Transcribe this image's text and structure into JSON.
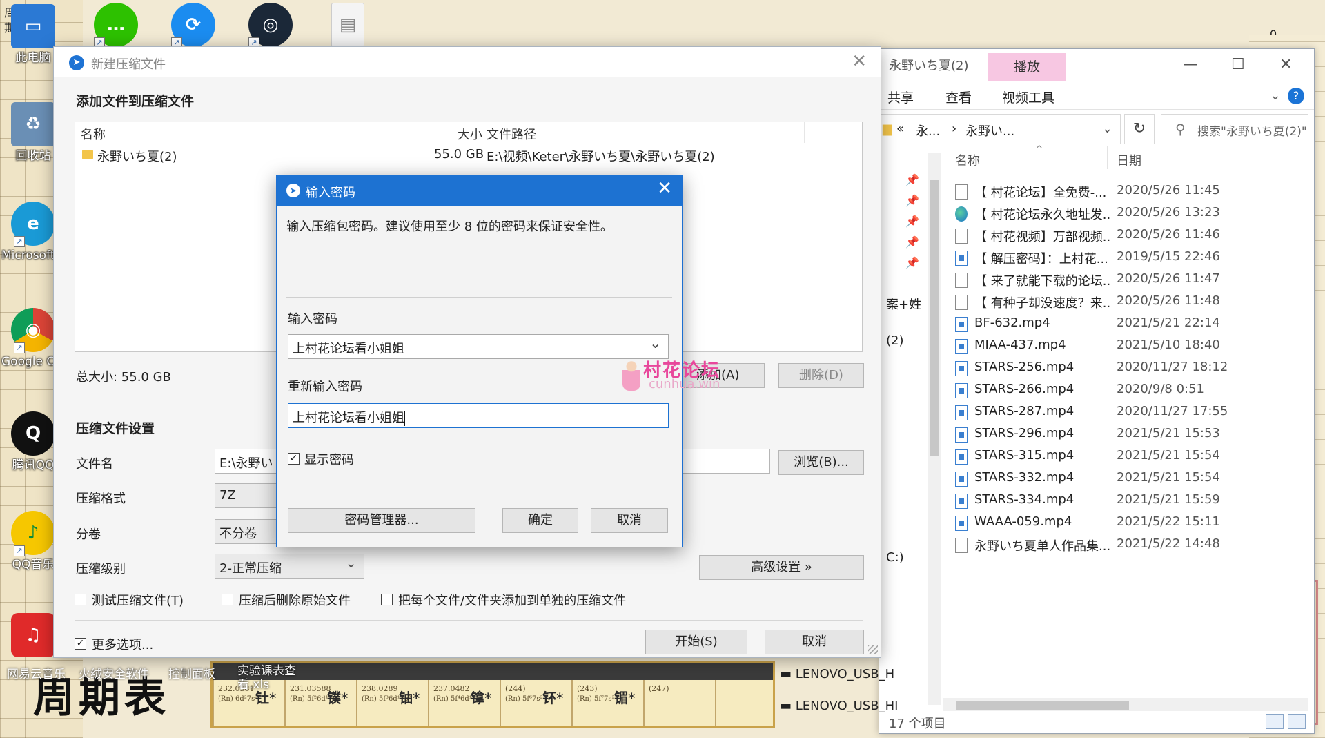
{
  "desktop": {
    "period_label": "周\n期",
    "big_label": "周期表",
    "column_zero": "0",
    "icons": [
      {
        "name": "此电脑",
        "color": "#2b79d4",
        "glyph": "▭"
      },
      {
        "name": "回收站",
        "color": "#6a8fb5",
        "glyph": "♻"
      },
      {
        "name": "Microsoft Edge",
        "color": "#1a9ad6",
        "glyph": "e"
      },
      {
        "name": "Google Chrome",
        "color": "#db4437",
        "glyph": "◉"
      },
      {
        "name": "腾讯QQ",
        "color": "#111111",
        "glyph": "Q"
      },
      {
        "name": "QQ音乐",
        "color": "#f6c700",
        "glyph": "♪"
      },
      {
        "name": "网易云音乐",
        "color": "#e02a2a",
        "glyph": "♫"
      }
    ],
    "top_icons": [
      {
        "name": "wechat",
        "color": "#2dc100",
        "glyph": "…"
      },
      {
        "name": "xunlei",
        "color": "#1b8cf0",
        "glyph": "⟳"
      },
      {
        "name": "steam",
        "color": "#1b2838",
        "glyph": "◎"
      },
      {
        "name": "document",
        "color": "#e8e8e8",
        "glyph": "▤"
      }
    ],
    "bottom_labels": [
      "网易云音乐",
      "火绒安全软件",
      "控制面板",
      "实验课表查看.xls"
    ],
    "pt_cells": [
      {
        "num": "232.0381",
        "sym": "钍*",
        "cfg": "(Rn) 6d²7s²"
      },
      {
        "num": "231.03588",
        "sym": "镤*",
        "cfg": "(Rn) 5f²6d¹7s²"
      },
      {
        "num": "238.0289",
        "sym": "铀*",
        "cfg": "(Rn) 5f³6d¹7s²"
      },
      {
        "num": "237.0482",
        "sym": "镎*",
        "cfg": "(Rn) 5f⁴6d¹7s²"
      },
      {
        "num": "(244)",
        "sym": "钚*",
        "cfg": "(Rn) 5f⁶7s²"
      },
      {
        "num": "(243)",
        "sym": "镅*",
        "cfg": "(Rn) 5f⁷7s²"
      },
      {
        "num": "(247)",
        "sym": "",
        "cfg": ""
      }
    ]
  },
  "explorer": {
    "title": "永野いち夏(2)",
    "play_tab": "播放",
    "ribbon": {
      "share": "共享",
      "view": "查看",
      "video_tools": "视频工具"
    },
    "help": "?",
    "address": {
      "back": "«",
      "seg1": "永...",
      "seg2": "永野い...",
      "chevron": "⌄"
    },
    "refresh": "↻",
    "search_placeholder": "搜索\"永野いち夏(2)\"",
    "search_icon": "⚲",
    "nav_fragments": [
      "案+姓",
      "(2)",
      "C:)"
    ],
    "columns": {
      "name": "名称",
      "date": "日期",
      "sort": "^"
    },
    "files": [
      {
        "name": "【 村花论坛】全免费-...",
        "date": "2020/5/26 11:45",
        "type": "doc"
      },
      {
        "name": "【 村花论坛永久地址发...",
        "date": "2020/5/26 13:23",
        "type": "web"
      },
      {
        "name": "【 村花视频】万部视频...",
        "date": "2020/5/26 11:46",
        "type": "doc"
      },
      {
        "name": "【 解压密码】：上村花...",
        "date": "2019/5/15 22:46",
        "type": "video"
      },
      {
        "name": "【 来了就能下载的论坛...",
        "date": "2020/5/26 11:47",
        "type": "doc"
      },
      {
        "name": "【 有种子却没速度？来...",
        "date": "2020/5/26 11:48",
        "type": "doc"
      },
      {
        "name": "BF-632.mp4",
        "date": "2021/5/21 22:14",
        "type": "video"
      },
      {
        "name": "MIAA-437.mp4",
        "date": "2021/5/10 18:40",
        "type": "video"
      },
      {
        "name": "STARS-256.mp4",
        "date": "2020/11/27 18:12",
        "type": "video"
      },
      {
        "name": "STARS-266.mp4",
        "date": "2020/9/8 0:51",
        "type": "video"
      },
      {
        "name": "STARS-287.mp4",
        "date": "2020/11/27 17:55",
        "type": "video"
      },
      {
        "name": "STARS-296.mp4",
        "date": "2021/5/21 15:53",
        "type": "video"
      },
      {
        "name": "STARS-315.mp4",
        "date": "2021/5/21 15:54",
        "type": "video"
      },
      {
        "name": "STARS-332.mp4",
        "date": "2021/5/21 15:54",
        "type": "video"
      },
      {
        "name": "STARS-334.mp4",
        "date": "2021/5/21 15:59",
        "type": "video"
      },
      {
        "name": "WAAA-059.mp4",
        "date": "2021/5/22 15:11",
        "type": "video"
      },
      {
        "name": "永野いち夏单人作品集....",
        "date": "2021/5/22 14:48",
        "type": "doc"
      }
    ],
    "status": "17 个项目",
    "lenovo_items": [
      "LENOVO_USB_H",
      "LENOVO_USB_HI"
    ]
  },
  "compress": {
    "title": "新建压缩文件",
    "heading": "添加文件到压缩文件",
    "list_headers": {
      "name": "名称",
      "size": "大小",
      "path": "文件路径"
    },
    "item": {
      "name": "永野いち夏(2)",
      "size": "55.0 GB",
      "path": "E:\\视频\\Keter\\永野いち夏\\永野いち夏(2)"
    },
    "total": "总大小: 55.0 GB",
    "add_btn": "添加(A)",
    "delete_btn": "删除(D)",
    "settings_heading": "压缩文件设置",
    "labels": {
      "filename": "文件名",
      "format": "压缩格式",
      "volume": "分卷",
      "level": "压缩级别"
    },
    "filename_value": "E:\\永野い",
    "format_value": "7Z",
    "volume_value": "不分卷",
    "level_value": "2-正常压缩",
    "browse_btn": "浏览(B)...",
    "advanced_btn": "高级设置 »",
    "options": {
      "test": "测试压缩文件(T)",
      "delete_after": "压缩后删除原始文件",
      "separate": "把每个文件/文件夹添加到单独的压缩文件",
      "more": "更多选项..."
    },
    "start_btn": "开始(S)",
    "cancel_btn": "取消"
  },
  "password_dialog": {
    "title": "输入密码",
    "description": "输入压缩包密码。建议使用至少 8 位的密码来保证安全性。",
    "label_password": "输入密码",
    "password_value": "上村花论坛看小姐姐",
    "label_confirm": "重新输入密码",
    "confirm_value": "上村花论坛看小姐姐",
    "show_password": "显示密码",
    "show_password_checked": "✓",
    "manager_btn": "密码管理器...",
    "ok_btn": "确定",
    "cancel_btn": "取消"
  },
  "watermark": {
    "main": "村花论坛",
    "sub": "cunhua.win"
  }
}
